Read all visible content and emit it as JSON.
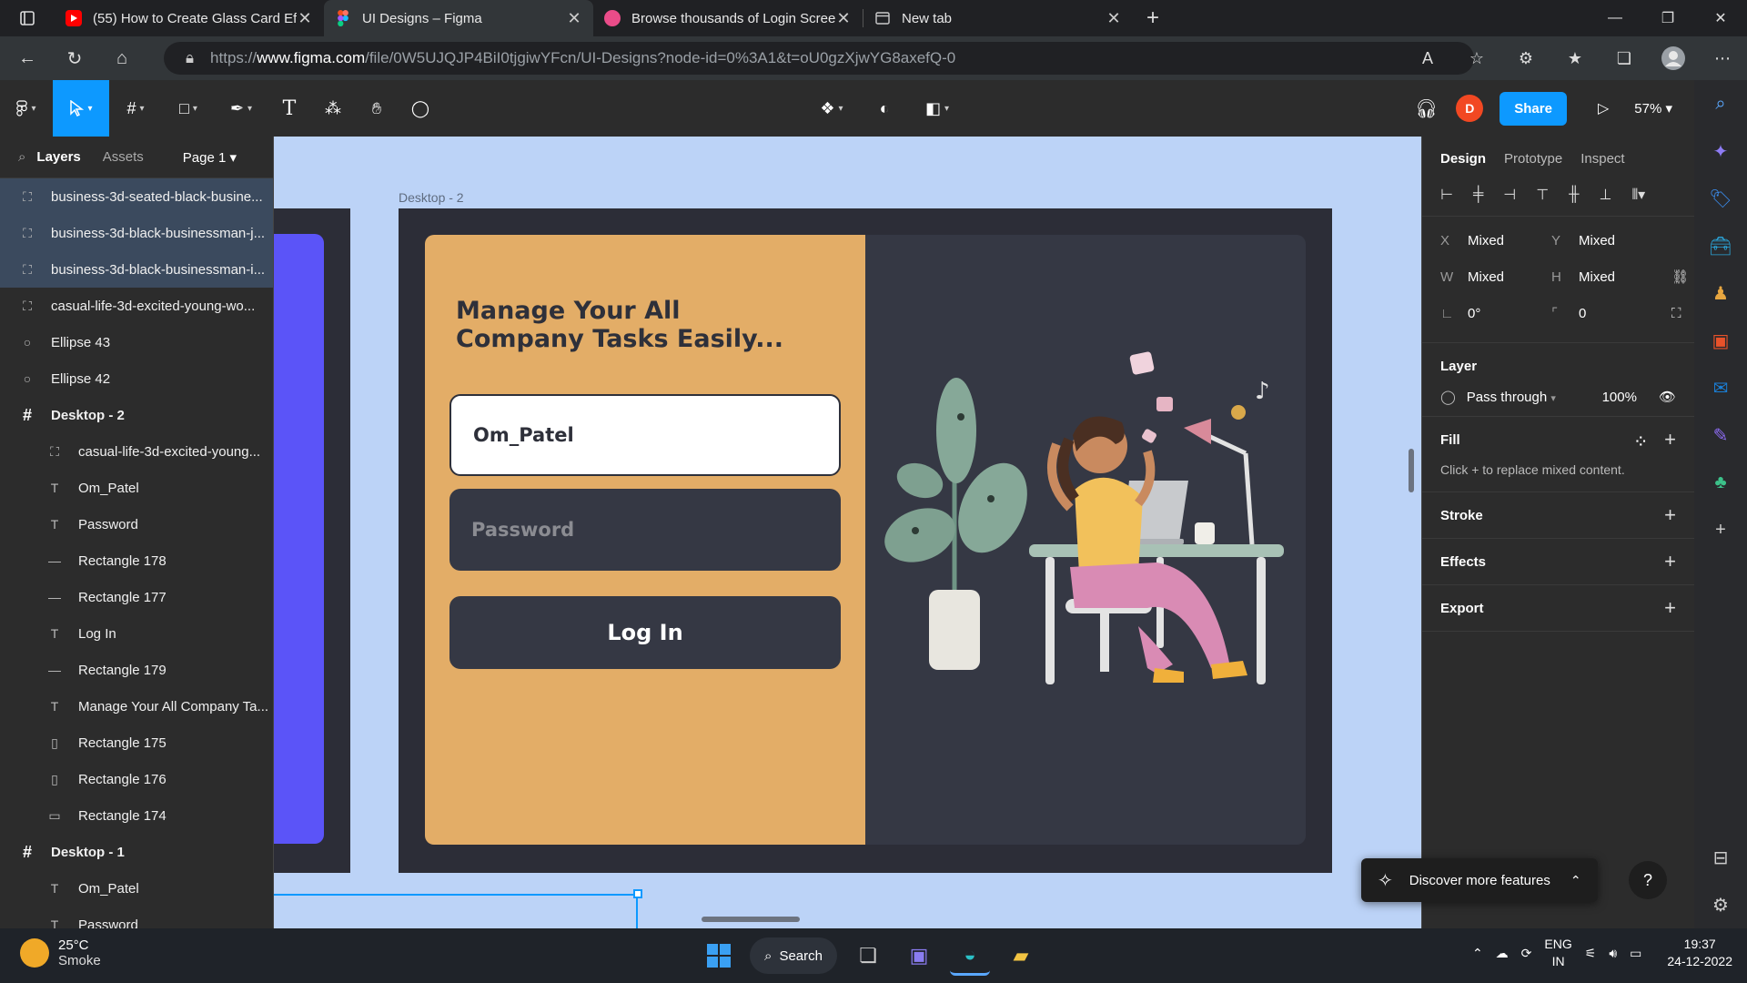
{
  "browser": {
    "tabs": [
      {
        "title": "(55) How to Create Glass Card Ef",
        "favicon_color": "#ff0000"
      },
      {
        "title": "UI Designs – Figma",
        "favicon_color": "#f24e1e"
      },
      {
        "title": "Browse thousands of Login Scree",
        "favicon_color": "#ea4c89"
      },
      {
        "title": "New tab",
        "favicon_color": "#5f6368"
      }
    ],
    "url_prefix": "https://",
    "url_domain": "www.figma.com",
    "url_path": "/file/0W5UJQJP4BiI0tjgiwYFcn/UI-Designs?node-id=0%3A1&t=oU0gzXjwYG8axefQ-0"
  },
  "toolbar": {
    "share_label": "Share",
    "avatar_initial": "D",
    "zoom": "57%"
  },
  "layers_panel": {
    "tab_layers": "Layers",
    "tab_assets": "Assets",
    "page": "Page 1",
    "layers": [
      {
        "name": "business-3d-seated-black-busine...",
        "type": "image",
        "level": 0,
        "selected": true
      },
      {
        "name": "business-3d-black-businessman-j...",
        "type": "image",
        "level": 0,
        "selected": true
      },
      {
        "name": "business-3d-black-businessman-i...",
        "type": "image",
        "level": 0,
        "selected": true
      },
      {
        "name": "casual-life-3d-excited-young-wo...",
        "type": "image",
        "level": 0,
        "selected": false
      },
      {
        "name": "Ellipse 43",
        "type": "ellipse",
        "level": 0,
        "selected": false
      },
      {
        "name": "Ellipse 42",
        "type": "ellipse",
        "level": 0,
        "selected": false
      },
      {
        "name": "Desktop - 2",
        "type": "frame",
        "level": 0,
        "selected": false
      },
      {
        "name": "casual-life-3d-excited-young...",
        "type": "image",
        "level": 1,
        "selected": false
      },
      {
        "name": "Om_Patel",
        "type": "text",
        "level": 1,
        "selected": false
      },
      {
        "name": "Password",
        "type": "text",
        "level": 1,
        "selected": false
      },
      {
        "name": "Rectangle 178",
        "type": "line",
        "level": 1,
        "selected": false
      },
      {
        "name": "Rectangle 177",
        "type": "line",
        "level": 1,
        "selected": false
      },
      {
        "name": "Log In",
        "type": "text",
        "level": 1,
        "selected": false
      },
      {
        "name": "Rectangle 179",
        "type": "line",
        "level": 1,
        "selected": false
      },
      {
        "name": "Manage Your All Company Ta...",
        "type": "text",
        "level": 1,
        "selected": false
      },
      {
        "name": "Rectangle 175",
        "type": "rect-tall",
        "level": 1,
        "selected": false
      },
      {
        "name": "Rectangle 176",
        "type": "rect-tall",
        "level": 1,
        "selected": false
      },
      {
        "name": "Rectangle 174",
        "type": "rect",
        "level": 1,
        "selected": false
      },
      {
        "name": "Desktop - 1",
        "type": "frame",
        "level": 0,
        "selected": false
      },
      {
        "name": "Om_Patel",
        "type": "text",
        "level": 1,
        "selected": false
      },
      {
        "name": "Password",
        "type": "text",
        "level": 1,
        "selected": false
      }
    ]
  },
  "canvas": {
    "frame_label": "Desktop - 2",
    "headline_line1": "Manage Your All",
    "headline_line2": "Company Tasks Easily...",
    "username_value": "Om_Patel",
    "password_placeholder": "Password",
    "login_label": "Log In",
    "colors": {
      "card_left": "#e3ad67",
      "card_right": "#353844",
      "frame": "#2c2d37",
      "canvas_bg": "#bcd3f7",
      "accent_blue": "#5b54f8"
    }
  },
  "design_panel": {
    "tabs": [
      "Design",
      "Prototype",
      "Inspect"
    ],
    "x_label": "X",
    "x_value": "Mixed",
    "y_label": "Y",
    "y_value": "Mixed",
    "w_label": "W",
    "w_value": "Mixed",
    "h_label": "H",
    "h_value": "Mixed",
    "rotation": "0°",
    "radius": "0",
    "layer_title": "Layer",
    "blend_mode": "Pass through",
    "opacity": "100%",
    "fill_title": "Fill",
    "fill_text": "Click + to replace mixed content.",
    "stroke_title": "Stroke",
    "effects_title": "Effects",
    "export_title": "Export"
  },
  "discover_label": "Discover more features",
  "help_label": "?",
  "taskbar": {
    "temperature": "25°C",
    "weather": "Smoke",
    "search_label": "Search",
    "lang_top": "ENG",
    "lang_bottom": "IN",
    "time": "19:37",
    "date": "24-12-2022"
  }
}
